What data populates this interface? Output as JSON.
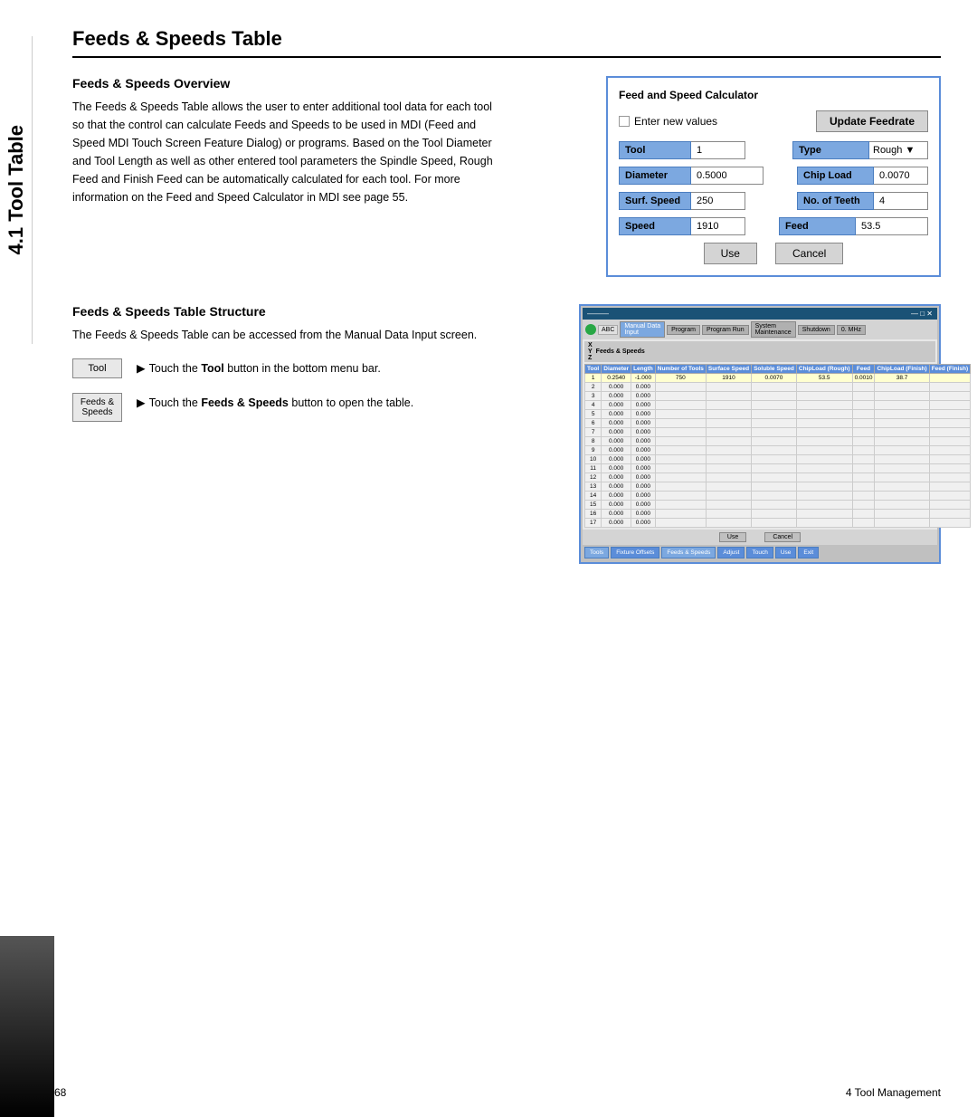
{
  "side_tab": {
    "label": "4.1 Tool Table"
  },
  "page_title": "Feeds & Speeds Table",
  "overview": {
    "title": "Feeds & Speeds Overview",
    "body": "The Feeds & Speeds Table allows the user to enter additional tool data for each tool so that the control can calculate Feeds and Speeds to be used in MDI (Feed and Speed MDI Touch Screen Feature Dialog) or programs.  Based on the Tool Diameter and Tool Length as well as other entered tool parameters the Spindle Speed, Rough Feed and Finish Feed can be automatically calculated for each tool. For more information on the Feed and Speed Calculator in MDI see page 55."
  },
  "calculator": {
    "title": "Feed and Speed Calculator",
    "checkbox_label": "Enter new values",
    "update_btn": "Update Feedrate",
    "fields": [
      {
        "label": "Tool",
        "value": "1",
        "side_label": "Type",
        "side_value": "Rough",
        "has_dropdown": true
      },
      {
        "label": "Diameter",
        "value": "0.5000",
        "side_label": "Chip Load",
        "side_value": "0.0070"
      },
      {
        "label": "Surf. Speed",
        "value": "250",
        "side_label": "No. of Teeth",
        "side_value": "4"
      },
      {
        "label": "Speed",
        "value": "1910",
        "side_label": "Feed",
        "side_value": "53.5"
      }
    ],
    "use_btn": "Use",
    "cancel_btn": "Cancel"
  },
  "structure": {
    "title": "Feeds & Speeds Table Structure",
    "body": "The Feeds & Speeds Table can be accessed from the Manual Data Input screen.",
    "instructions": [
      {
        "btn_label": "Tool",
        "text": "Touch the Tool button in the bottom menu bar."
      },
      {
        "btn_label": "Feeds &\nSpeeds",
        "text": "Touch the Feeds & Speeds button to open the table."
      }
    ]
  },
  "footer": {
    "page_number": "68",
    "section": "4 Tool Management"
  }
}
